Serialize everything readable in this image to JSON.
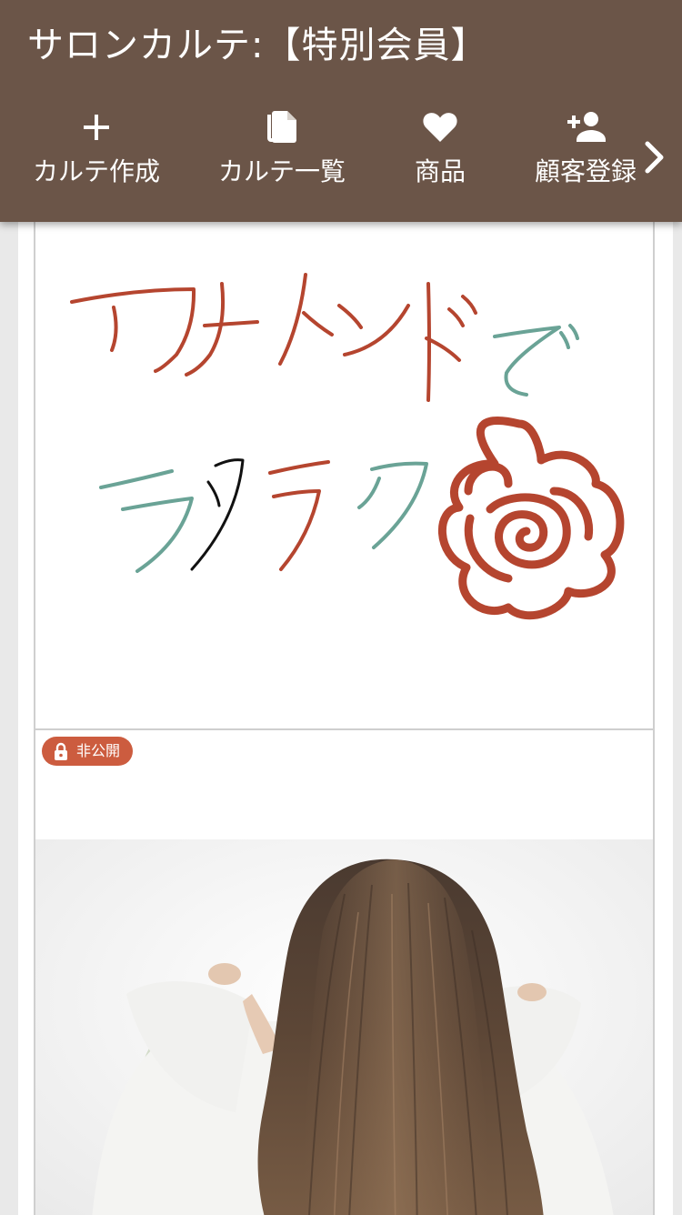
{
  "header": {
    "title": "サロンカルテ:【特別会員】",
    "background_color": "#6b5548"
  },
  "nav": {
    "items": [
      {
        "label": "カルテ作成",
        "icon": "plus-icon"
      },
      {
        "label": "カルテ一覧",
        "icon": "copy-document-icon"
      },
      {
        "label": "商品",
        "icon": "heart-icon"
      },
      {
        "label": "顧客登録",
        "icon": "add-person-icon"
      }
    ],
    "next_icon": "chevron-right-icon"
  },
  "cards": [
    {
      "type": "freehand-drawing",
      "colors": {
        "red": "#b5452f",
        "teal": "#6aa396",
        "black": "#111111"
      }
    },
    {
      "type": "photo",
      "badge": {
        "label": "非公開",
        "icon": "lock-icon",
        "color": "#cc5c3f"
      }
    }
  ]
}
